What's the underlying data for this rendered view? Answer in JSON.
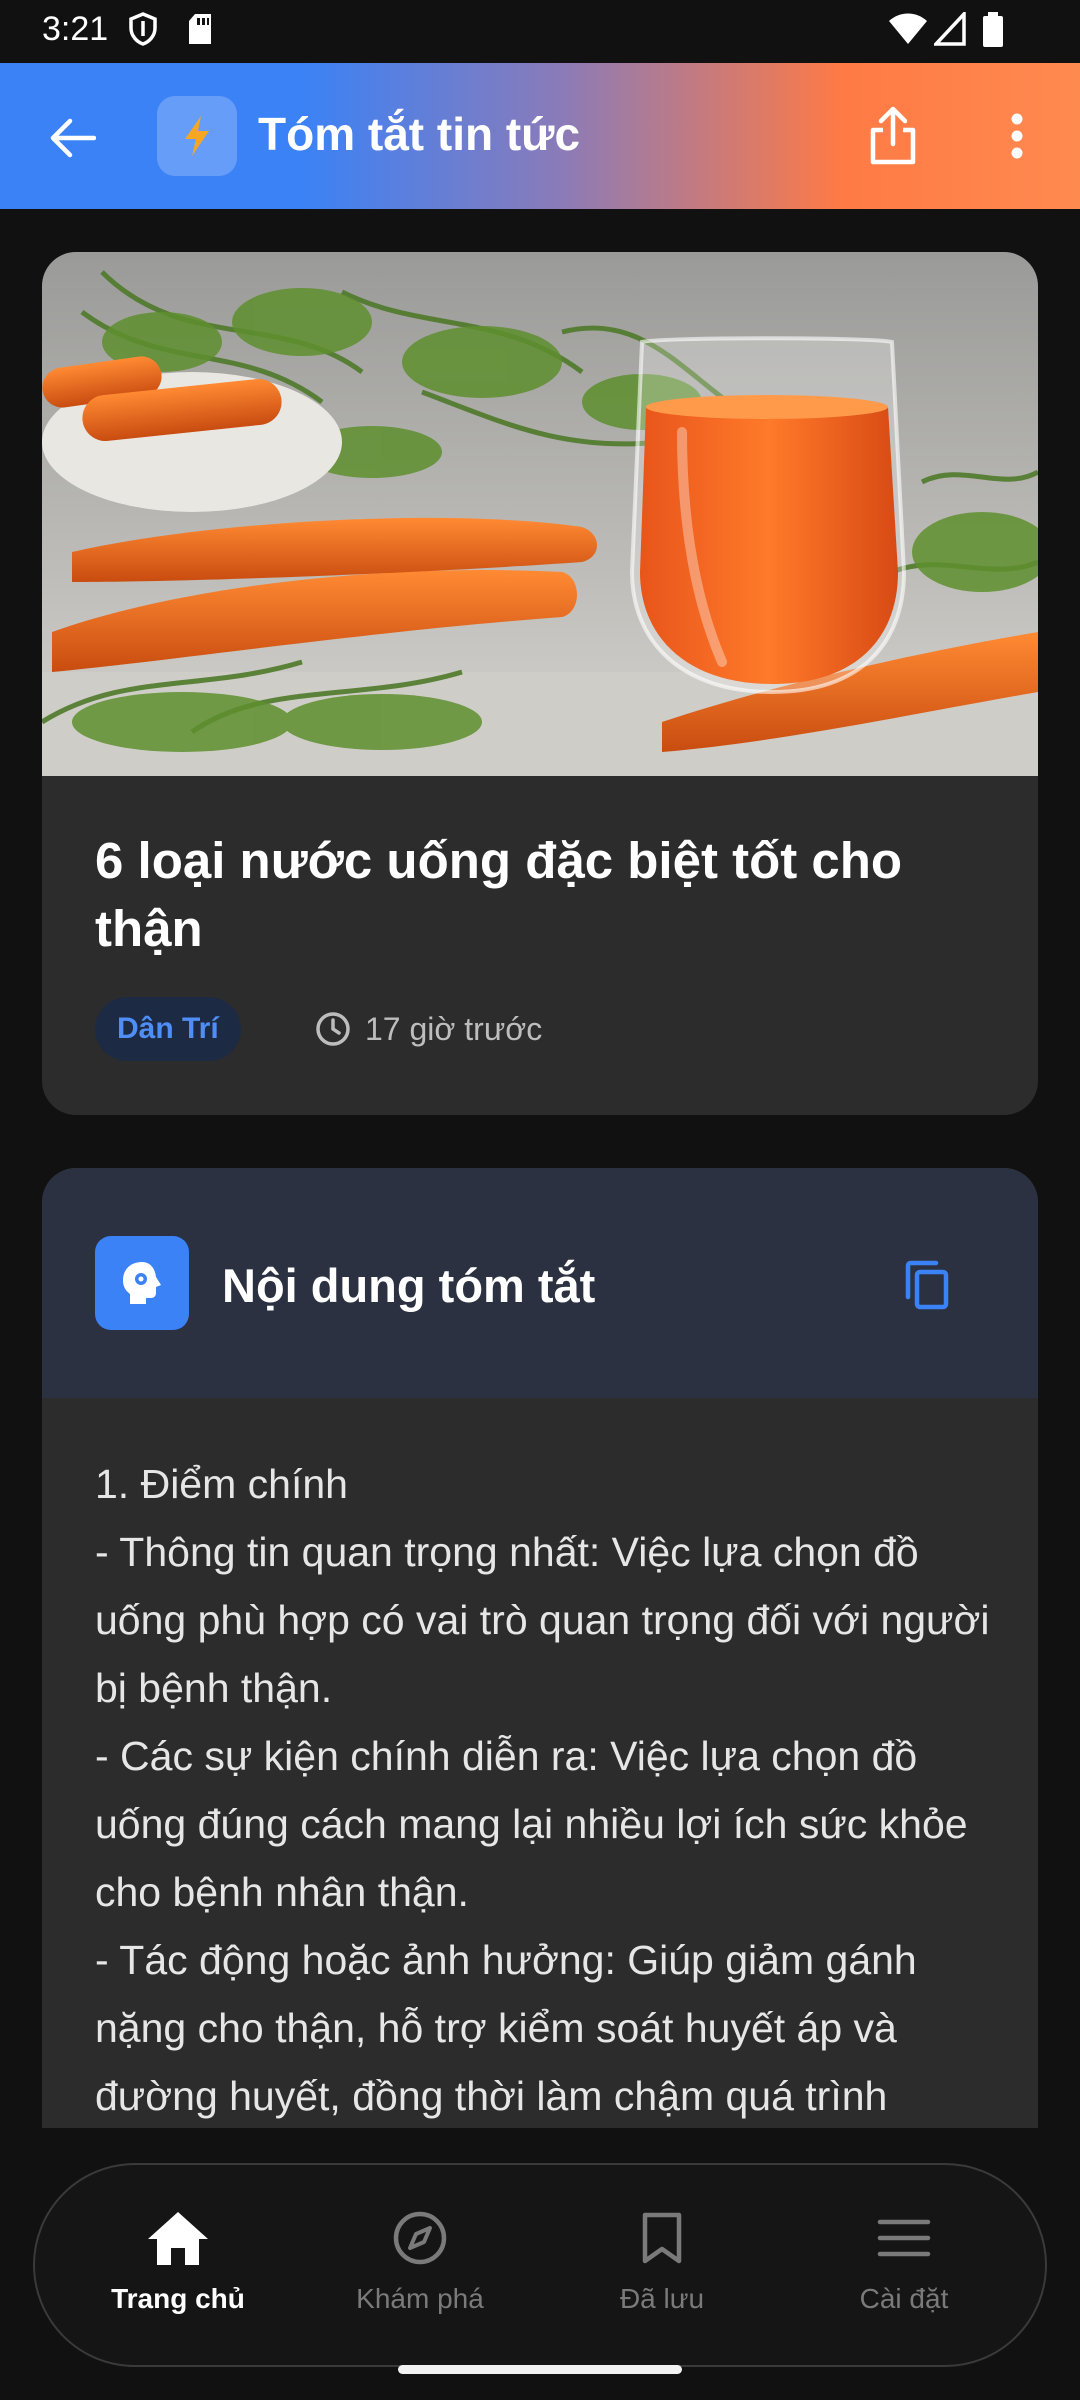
{
  "status_bar": {
    "time": "3:21"
  },
  "app_bar": {
    "title": "Tóm tắt tin tức"
  },
  "article": {
    "title": "6 loại nước uống đặc biệt tốt cho thận",
    "source": "Dân Trí",
    "time_ago": "17 giờ trước"
  },
  "summary": {
    "header": "Nội dung tóm tắt",
    "lines": [
      "1. Điểm chính",
      "- Thông tin quan trọng nhất: Việc lựa chọn đồ uống phù hợp có vai trò quan trọng đối với người bị bệnh thận.",
      "- Các sự kiện chính diễn ra: Việc lựa chọn đồ uống đúng cách mang lại nhiều lợi ích sức khỏe cho bệnh nhân thận.",
      "- Tác động hoặc ảnh hưởng: Giúp giảm gánh nặng cho thận, hỗ trợ kiểm soát huyết áp và đường huyết, đồng thời làm chậm quá trình"
    ]
  },
  "bottom_nav": {
    "items": [
      {
        "label": "Trang chủ",
        "icon": "home-icon",
        "active": true
      },
      {
        "label": "Khám phá",
        "icon": "compass-icon",
        "active": false
      },
      {
        "label": "Đã lưu",
        "icon": "bookmark-icon",
        "active": false
      },
      {
        "label": "Cài đặt",
        "icon": "menu-icon",
        "active": false
      }
    ]
  },
  "colors": {
    "accent": "#3b82f6",
    "gradient_end": "#ff7a45",
    "background": "#111111",
    "card": "#2c2c2c"
  }
}
